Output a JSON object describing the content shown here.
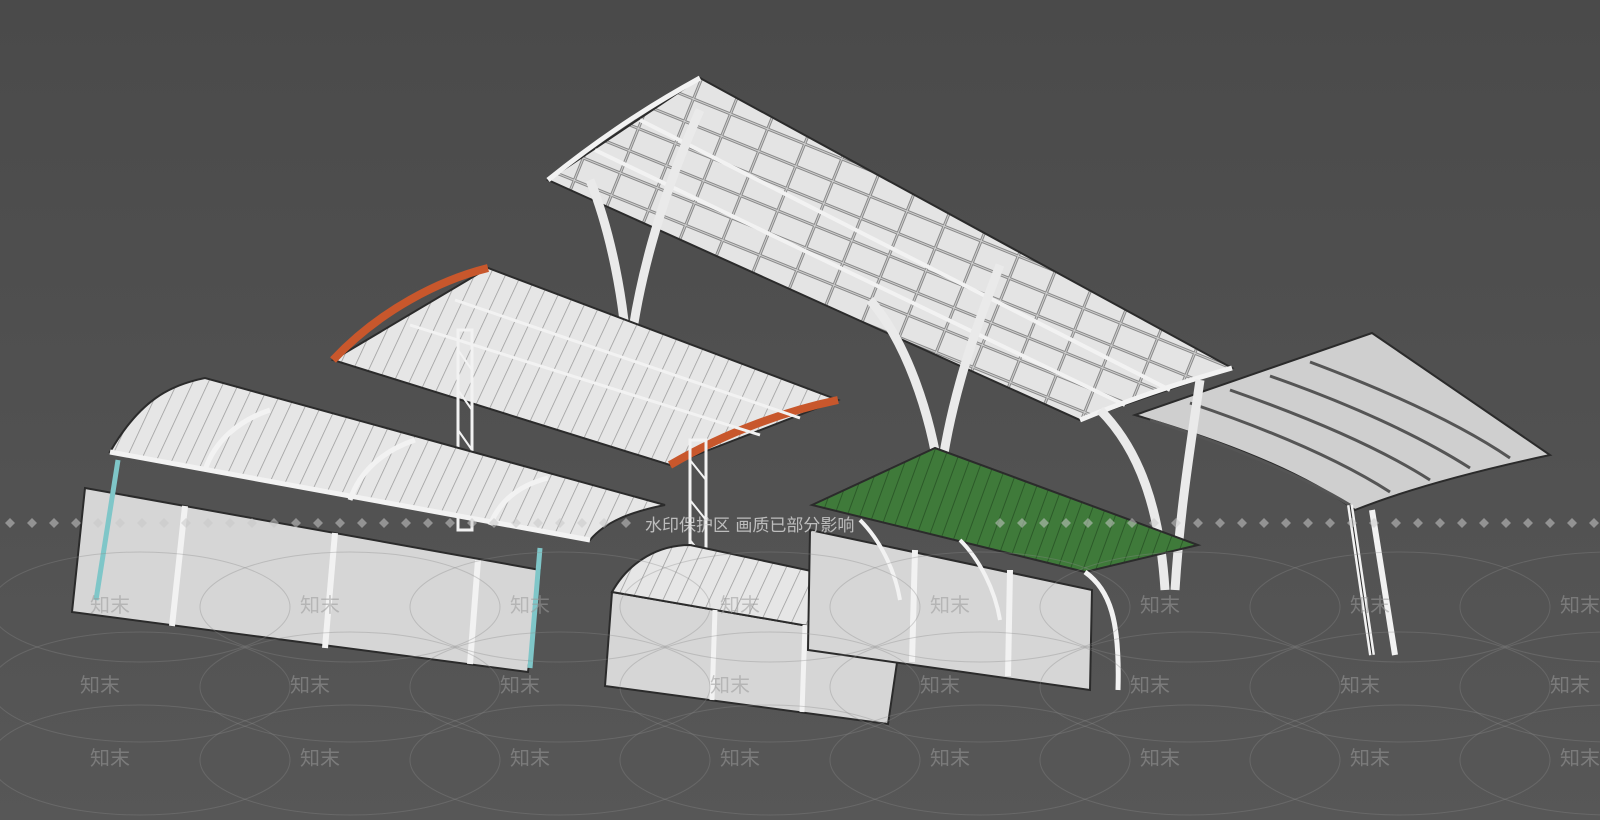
{
  "colors": {
    "background_top": "#4a4a4a",
    "background_bottom": "#575757",
    "frame_white": "#f2f2f2",
    "outline": "#2b2b2b",
    "panel_gray": "#d6d6d6",
    "roof_accent_orange": "#c8572c",
    "roof_accent_green": "#3f7a3a",
    "glass_cyan": "#7fc6c8"
  },
  "watermark": {
    "band_text": "水印保护区  画质已部分影响",
    "brand": "知末"
  },
  "models": [
    {
      "name": "canopy-with-back-panels-left"
    },
    {
      "name": "canopy-orange-edge"
    },
    {
      "name": "canopy-tall-y-column"
    },
    {
      "name": "canopy-small-arch"
    },
    {
      "name": "canopy-green-roof"
    },
    {
      "name": "canopy-curved-right"
    }
  ]
}
